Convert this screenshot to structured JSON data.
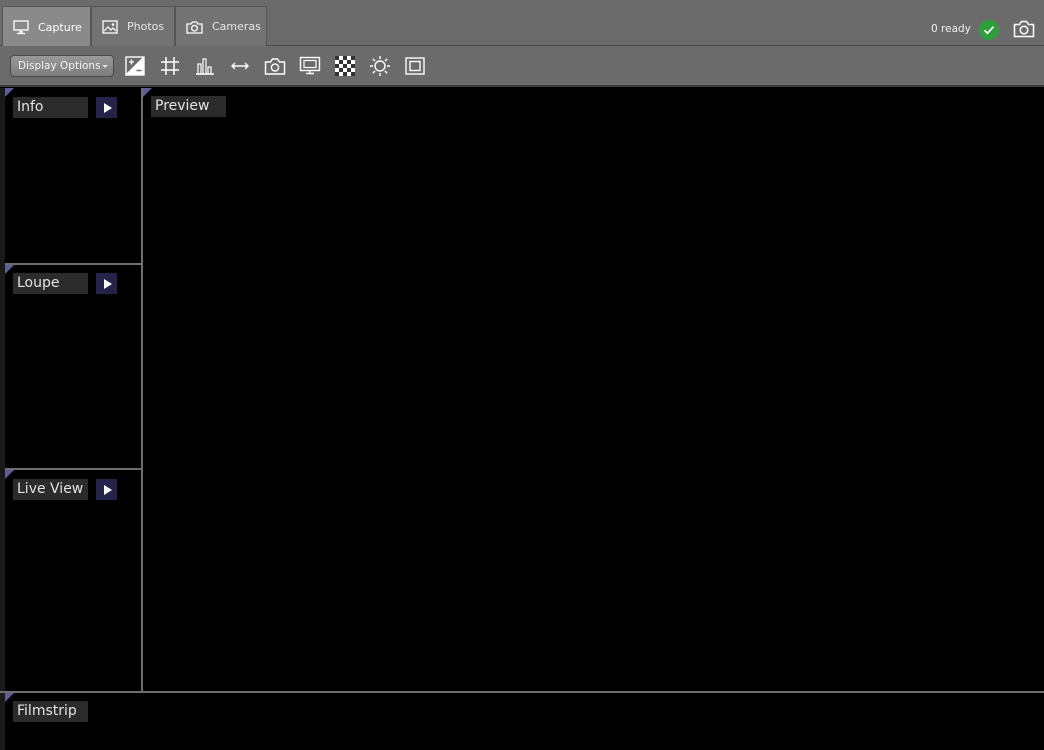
{
  "tabs": [
    {
      "label": "Capture",
      "icon": "monitor-icon",
      "active": true
    },
    {
      "label": "Photos",
      "icon": "image-icon",
      "active": false
    },
    {
      "label": "Cameras",
      "icon": "camera-icon",
      "active": false
    }
  ],
  "status": {
    "ready_text": "0 ready",
    "ready_icon": "check-icon",
    "ready_color": "#2e9e3c"
  },
  "toolbar": {
    "display_options_label": "Display Options",
    "tools": [
      "exposure-icon",
      "grid-icon",
      "histogram-icon",
      "fit-width-icon",
      "capture-snapshot-icon",
      "preview-screen-icon",
      "checkerboard-icon",
      "brightness-icon",
      "crop-frame-icon"
    ]
  },
  "panels": {
    "info": "Info",
    "loupe": "Loupe",
    "live_view": "Live View",
    "preview": "Preview",
    "filmstrip": "Filmstrip"
  },
  "colors": {
    "chrome": "#6b6b6b",
    "panel_bg": "#000000",
    "corner_accent": "#5e5e96",
    "expand_button": "#24244a"
  }
}
